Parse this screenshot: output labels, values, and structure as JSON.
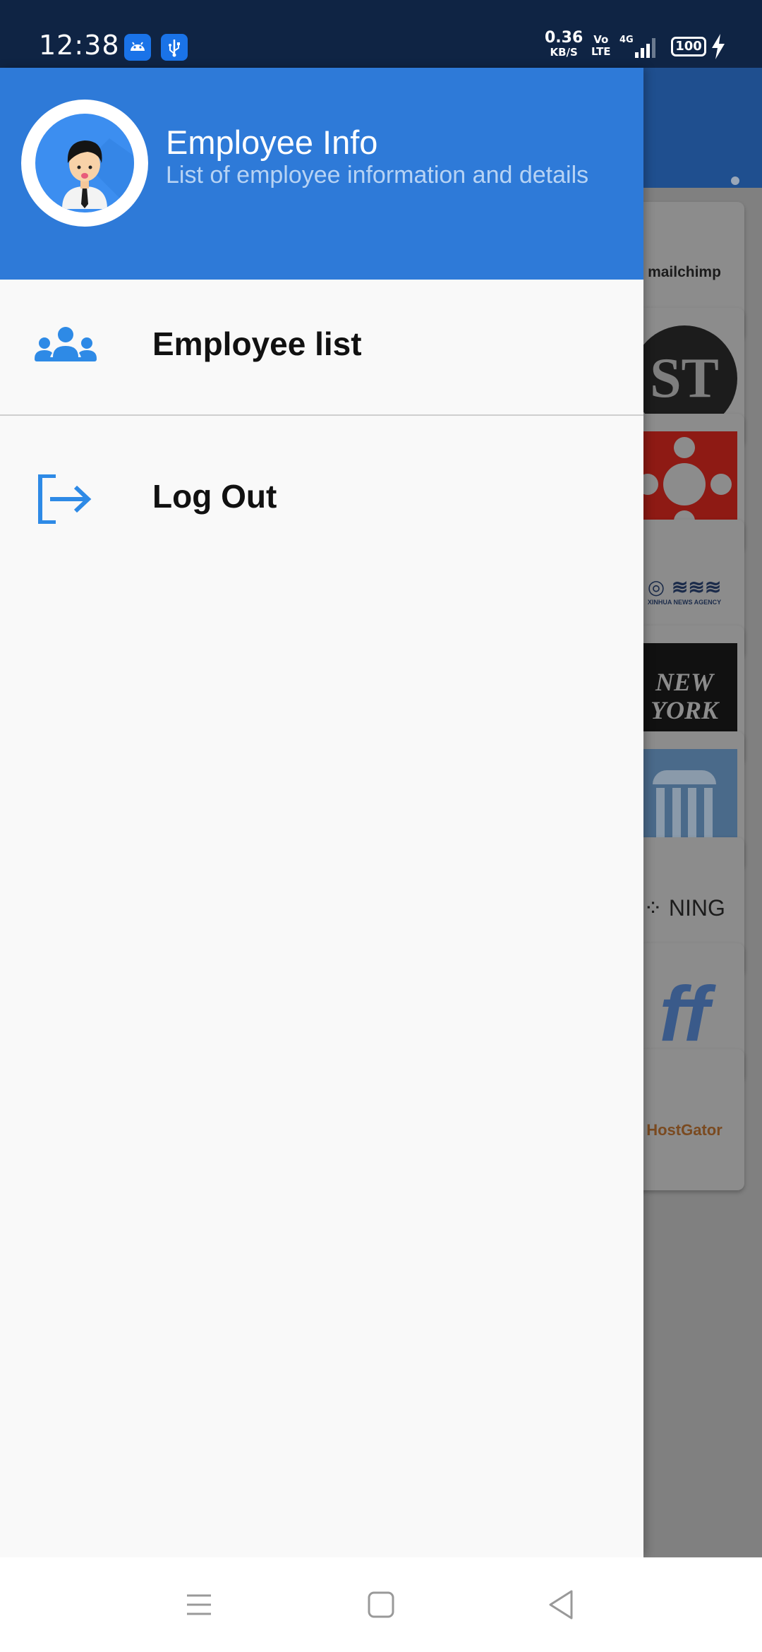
{
  "status_bar": {
    "time": "12:38",
    "net_speed": "0.36",
    "net_speed_unit": "KB/S",
    "volte_top": "Vo",
    "volte_bottom": "LTE",
    "network": "4G",
    "battery": "100"
  },
  "drawer": {
    "header": {
      "title": "Employee Info",
      "subtitle": "List of employee information and details"
    },
    "items": [
      {
        "label": "Employee list",
        "icon": "group-icon"
      },
      {
        "label": "Log Out",
        "icon": "logout-icon"
      }
    ]
  },
  "background_list": {
    "logos": [
      {
        "name": "mailchimp-logo",
        "text": "mailchimp"
      },
      {
        "name": "st-logo",
        "text": "ST"
      },
      {
        "name": "cbc-logo",
        "text": ""
      },
      {
        "name": "xinhua-logo",
        "text": "XINHUA NEWS AGENCY"
      },
      {
        "name": "new-york-logo",
        "text": "NEW YORK"
      },
      {
        "name": "columns-logo",
        "text": ""
      },
      {
        "name": "ning-logo",
        "text": "NING"
      },
      {
        "name": "ff-logo",
        "text": "ff"
      },
      {
        "name": "hostgator-logo",
        "text": "HostGator"
      }
    ]
  },
  "colors": {
    "status_bar": "#0f2444",
    "drawer_header": "#2e7ad8",
    "icon_blue": "#2e8ae6",
    "scrim": "#808080"
  }
}
